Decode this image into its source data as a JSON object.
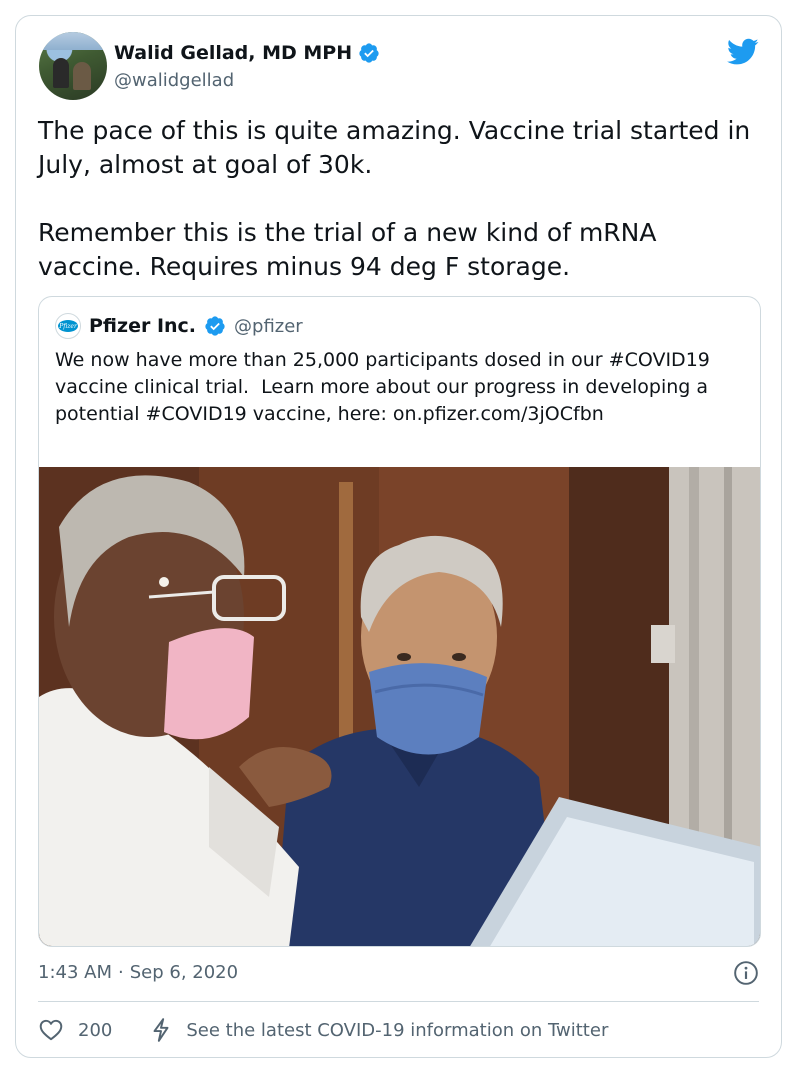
{
  "author": {
    "name": "Walid Gellad, MD MPH",
    "handle": "@walidgellad"
  },
  "tweet": {
    "text": "The pace of this is quite amazing. Vaccine trial started in July, almost at goal of 30k.\n\nRemember this is the trial of a new kind of mRNA vaccine. Requires minus 94 deg F storage."
  },
  "quoted_tweet": {
    "name": "Pfizer Inc.",
    "handle": "@pfizer",
    "logo_text": "Pfizer",
    "text": "We now have more than 25,000 participants dosed in our #COVID19 vaccine clinical trial.  Learn more about our progress in developing a potential #COVID19 vaccine, here: on.pfizer.com/3jOCfbn"
  },
  "meta": {
    "time": "1:43 AM",
    "separator": "·",
    "date": "Sep 6, 2020"
  },
  "actions": {
    "like_count": "200",
    "covid_info": "See the latest COVID-19 information on Twitter"
  },
  "colors": {
    "brand_blue": "#1d9bf0",
    "text_primary": "#0f1419",
    "text_secondary": "#536471",
    "border": "#cfd9de"
  },
  "icons": [
    "twitter-bird-icon",
    "verified-badge-icon",
    "info-icon",
    "heart-icon",
    "bolt-icon"
  ]
}
